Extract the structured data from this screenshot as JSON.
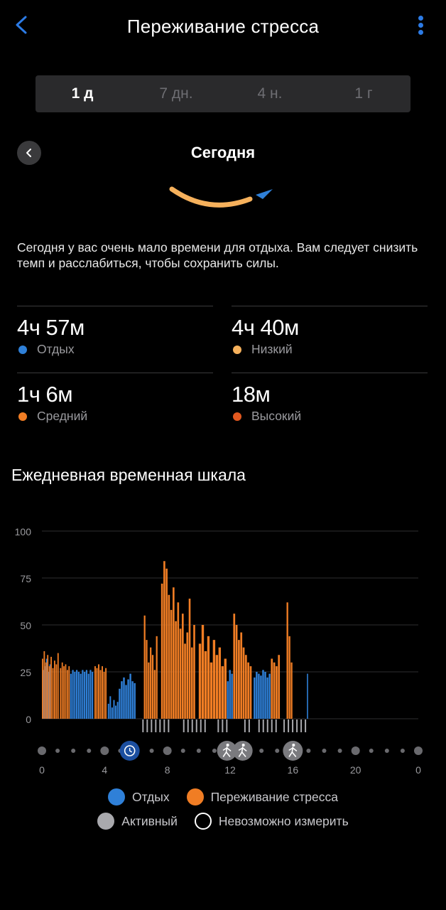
{
  "header": {
    "title": "Переживание стресса"
  },
  "range_tabs": [
    {
      "label": "1 д",
      "active": true
    },
    {
      "label": "7 дн.",
      "active": false
    },
    {
      "label": "4 н.",
      "active": false
    },
    {
      "label": "1 г",
      "active": false
    }
  ],
  "date_nav": {
    "title": "Сегодня"
  },
  "summary": "Сегодня у вас очень мало времени для отдыха. Вам следует снизить темп и расслабиться, чтобы сохранить силы.",
  "stats": [
    {
      "value": "4ч 57м",
      "label": "Отдых",
      "color": "#2f80d8"
    },
    {
      "value": "4ч 40м",
      "label": "Низкий",
      "color": "#f6b15c"
    },
    {
      "value": "1ч 6м",
      "label": "Средний",
      "color": "#f07d24"
    },
    {
      "value": "18м",
      "label": "Высокий",
      "color": "#e2581f"
    }
  ],
  "timeline_title": "Ежедневная временная шкала",
  "colors": {
    "rest": "#2f80d8",
    "stress": "#f07d24",
    "active": "#a9a9ad",
    "accent": "#2c7be5"
  },
  "chart_data": {
    "type": "bar",
    "title": "",
    "xlabel": "",
    "ylabel": "",
    "ylim": [
      0,
      100
    ],
    "yticks": [
      "100",
      "75",
      "50",
      "25",
      "0"
    ],
    "xticks": [
      "0",
      "4",
      "8",
      "12",
      "16",
      "20",
      "0"
    ],
    "xlim": [
      0,
      24
    ],
    "series": [
      {
        "name": "Отдых",
        "segments": [
          {
            "x": [
              0.05,
              0.55
            ],
            "levels": [
              26,
              30,
              28,
              32,
              27,
              25,
              29
            ]
          },
          {
            "x": [
              1.8,
              3.3
            ],
            "levels": [
              24,
              26,
              25,
              26,
              25,
              24,
              26,
              25,
              26,
              24,
              26,
              25
            ]
          },
          {
            "x": [
              4.2,
              4.9
            ],
            "levels": [
              8,
              12,
              6,
              10,
              7,
              9
            ]
          },
          {
            "x": [
              4.9,
              6.0
            ],
            "levels": [
              16,
              20,
              22,
              18,
              21,
              24,
              20,
              19
            ]
          },
          {
            "x": [
              11.8,
              12.2
            ],
            "levels": [
              20,
              26,
              24
            ]
          },
          {
            "x": [
              13.5,
              14.6
            ],
            "levels": [
              22,
              25,
              24,
              23,
              26,
              25,
              22,
              24
            ]
          },
          {
            "x": [
              16.9,
              17.0
            ],
            "levels": [
              24
            ]
          }
        ]
      },
      {
        "name": "Переживание стресса",
        "segments": [
          {
            "x": [
              0.0,
              1.1
            ],
            "levels": [
              32,
              36,
              30,
              34,
              28,
              33,
              27,
              31,
              29,
              35
            ]
          },
          {
            "x": [
              1.15,
              1.8
            ],
            "levels": [
              27,
              30,
              28,
              29,
              26,
              28
            ]
          },
          {
            "x": [
              3.35,
              4.15
            ],
            "levels": [
              28,
              27,
              29,
              26,
              28,
              25,
              27
            ]
          },
          {
            "x": [
              6.5,
              7.4
            ],
            "levels": [
              55,
              42,
              30,
              38,
              34,
              26,
              44
            ]
          },
          {
            "x": [
              7.6,
              9.8
            ],
            "levels": [
              72,
              84,
              80,
              66,
              58,
              70,
              52,
              62,
              48,
              56,
              40,
              46,
              64,
              38,
              50
            ]
          },
          {
            "x": [
              10.0,
              11.8
            ],
            "levels": [
              40,
              50,
              36,
              44,
              30,
              42,
              34,
              38,
              28,
              32
            ]
          },
          {
            "x": [
              12.2,
              13.4
            ],
            "levels": [
              56,
              50,
              42,
              46,
              38,
              34,
              30,
              28
            ]
          },
          {
            "x": [
              14.6,
              15.2
            ],
            "levels": [
              32,
              30,
              28,
              34
            ]
          },
          {
            "x": [
              15.6,
              16.0
            ],
            "levels": [
              62,
              44,
              30
            ]
          }
        ]
      },
      {
        "name": "Активный",
        "ranges": [
          [
            6.4,
            8.2
          ],
          [
            9.0,
            10.6
          ],
          [
            11.2,
            11.9
          ],
          [
            12.9,
            13.2
          ],
          [
            13.8,
            15.0
          ],
          [
            15.4,
            16.9
          ]
        ]
      }
    ],
    "activity_markers": [
      {
        "x": 5.6,
        "icon": "clock-icon"
      },
      {
        "x": 11.8,
        "icon": "walking-icon"
      },
      {
        "x": 12.8,
        "icon": "walking-icon"
      },
      {
        "x": 16.0,
        "icon": "walking-icon"
      }
    ]
  },
  "legend": [
    {
      "label": "Отдых",
      "color": "#2f80d8",
      "style": "filled"
    },
    {
      "label": "Переживание стресса",
      "color": "#f07d24",
      "style": "filled"
    },
    {
      "label": "Активный",
      "color": "#a9a9ad",
      "style": "filled"
    },
    {
      "label": "Невозможно измерить",
      "color": "#ffffff",
      "style": "outline"
    }
  ]
}
